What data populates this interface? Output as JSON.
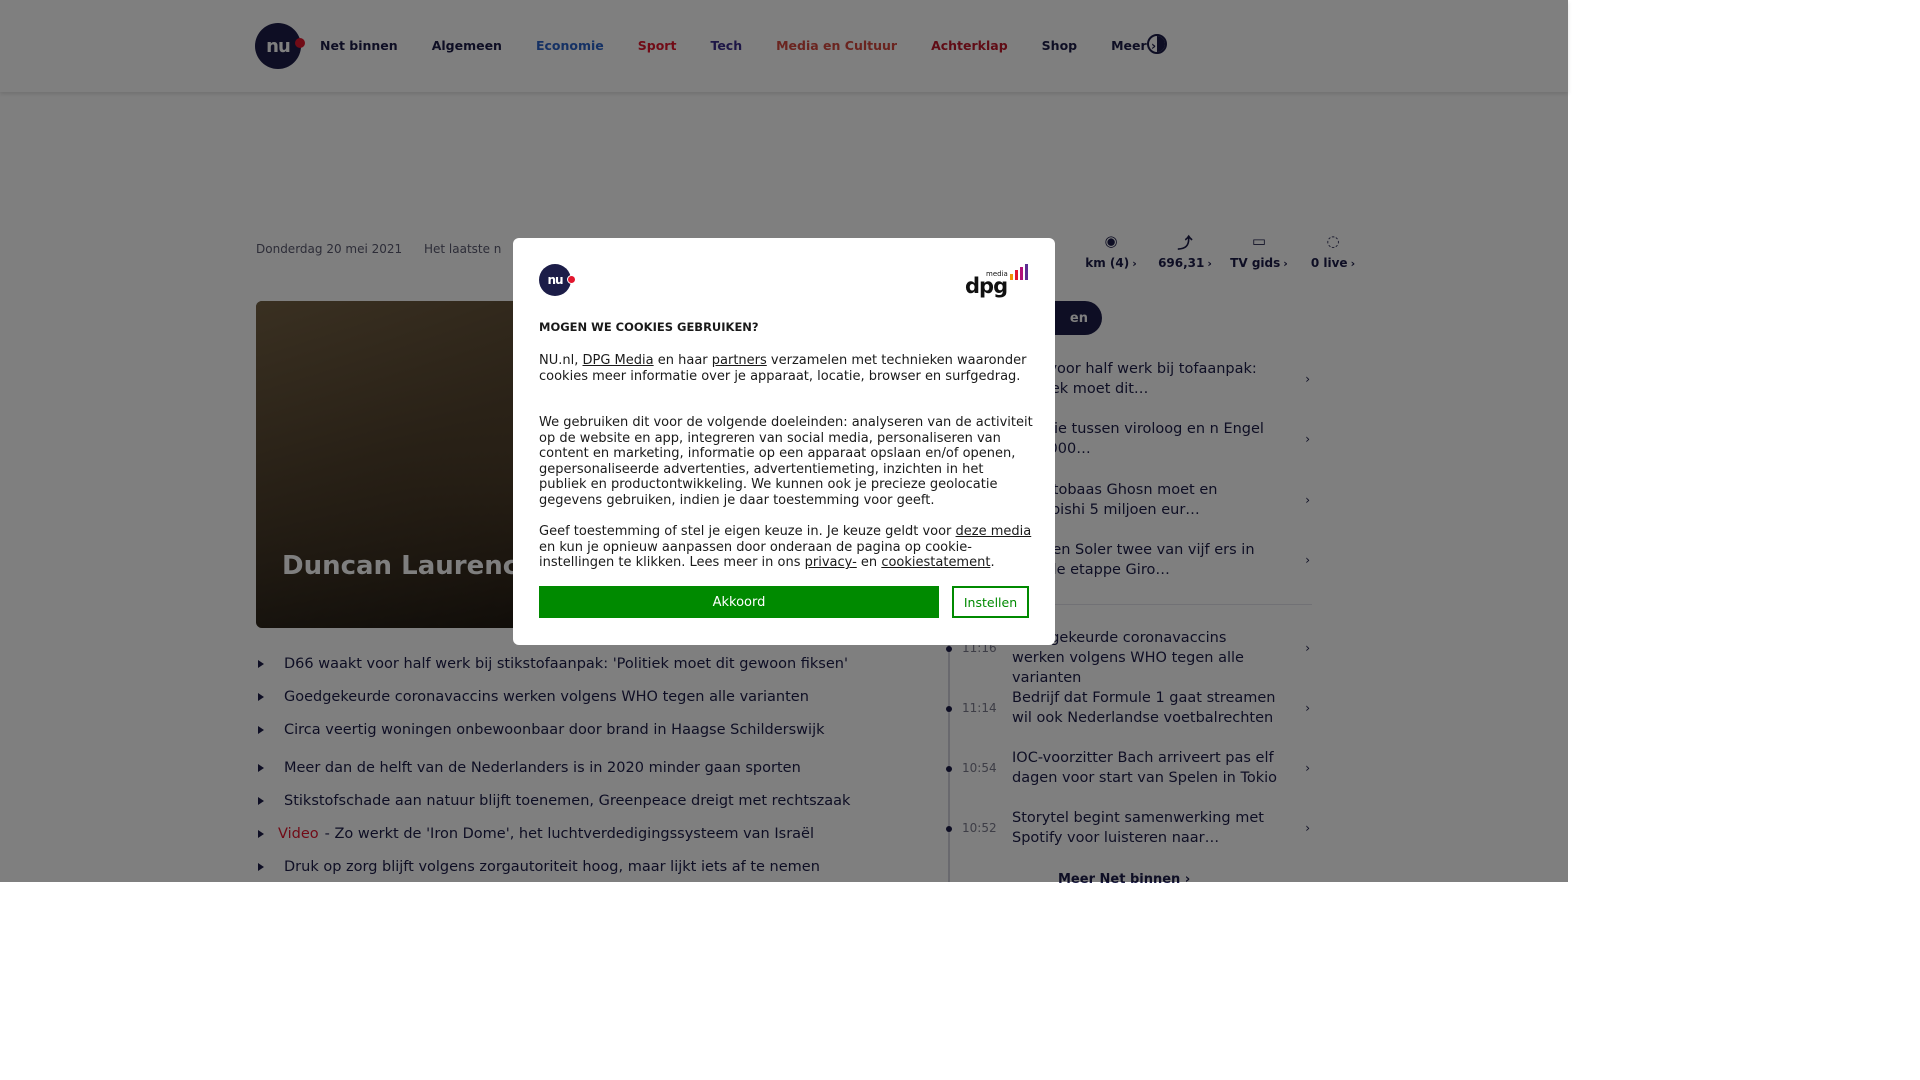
{
  "header": {
    "logo": "nu",
    "nav": [
      {
        "label": "Net binnen",
        "color": "#1c1d48"
      },
      {
        "label": "Algemeen",
        "color": "#1c1d48"
      },
      {
        "label": "Economie",
        "color": "#2a62c9"
      },
      {
        "label": "Sport",
        "color": "#e2162d"
      },
      {
        "label": "Tech",
        "color": "#3b2d8c"
      },
      {
        "label": "Media en Cultuur",
        "color": "#d4493f"
      },
      {
        "label": "Achterklap",
        "color": "#c0182b"
      },
      {
        "label": "Shop",
        "color": "#1c1d48"
      },
      {
        "label": "Meer",
        "color": "#1c1d48"
      }
    ],
    "theme_toggle_icon": "contrast-icon"
  },
  "subbar": {
    "date": "Donderdag 20 mei 2021",
    "latest": "Het laatste n",
    "quicklinks": [
      {
        "icon": "weather-icon",
        "label": ""
      },
      {
        "icon": "traffic-icon",
        "label": "km (4)"
      },
      {
        "icon": "stocks-icon",
        "label": "696,31"
      },
      {
        "icon": "tv-icon",
        "label": "TV gids"
      },
      {
        "icon": "chat-icon",
        "label": "0 live"
      }
    ]
  },
  "hero": {
    "title": "Duncan Laurence geen live gastopt"
  },
  "news": [
    {
      "tag": "",
      "text": "D66 waakt voor half werk bij stikstofaanpak: 'Politiek moet dit gewoon fiksen'"
    },
    {
      "tag": "",
      "text": "Goedgekeurde coronavaccins werken volgens WHO tegen alle varianten"
    },
    {
      "tag": "",
      "text": "Circa veertig woningen onbewoonbaar door brand in Haagse Schilderswijk"
    },
    {
      "tag": "",
      "text": "Meer dan de helft van de Nederlanders is in 2020 minder gaan sporten"
    },
    {
      "tag": "",
      "text": "Stikstofschade aan natuur blijft toenemen, Greenpeace dreigt met rechtszaak"
    },
    {
      "tag": "Video",
      "text": "- Zo werkt de 'Iron Dome', het luchtverdedigingssysteem van Israël"
    },
    {
      "tag": "",
      "text": "Druk op zorg blijft volgens zorgautoriteit hoog, maar lijkt iets af te nemen"
    }
  ],
  "sidebar": {
    "pill": "en",
    "top_items": [
      "aakt voor half werk bij tofaanpak: 'Politiek moet dit…",
      "er-ruzie tussen viroloog en n Engel op 2.000…",
      "en autobaas Ghosn moet en Mitsubishi 5 miljoen eur…",
      "archi en Soler twee van vijf ers in tweede etappe Giro…"
    ],
    "timeline_items": [
      {
        "time": "11:16",
        "text": "Goedgekeurde coronavaccins werken volgens WHO tegen alle varianten"
      },
      {
        "time": "11:14",
        "text": "Bedrijf dat Formule 1 gaat streamen wil ook Nederlandse voetbalrechten"
      },
      {
        "time": "10:54",
        "text": "IOC-voorzitter Bach arriveert pas elf dagen voor start van Spelen in Tokio"
      },
      {
        "time": "10:52",
        "text": "Storytel begint samenwerking met Spotify voor luisteren naar…"
      }
    ],
    "more": "Meer Net binnen"
  },
  "modal": {
    "logo": "nu",
    "brand": {
      "word": "dpg",
      "small": "media",
      "bar_colors": [
        "#f39200",
        "#e2162d",
        "#b1127a",
        "#5c2d91"
      ]
    },
    "title": "MOGEN WE COOKIES GEBRUIKEN?",
    "p1": {
      "a": "NU.nl, ",
      "link1": "DPG Media",
      "b": " en haar ",
      "link2": "partners",
      "c": " verzamelen met technieken waaronder cookies meer informatie over je apparaat, locatie, browser en surfgedrag."
    },
    "p2": "We gebruiken dit voor de volgende doeleinden: analyseren van de activiteit op de website en app, integreren van social media, personaliseren van content en marketing, informatie op een apparaat opslaan en/of openen, gepersonaliseerde advertenties, advertentiemeting, inzichten in het publiek en productontwikkeling. We kunnen ook je precieze geolocatie gegevens gebruiken, indien je daar toestemming voor geeft.",
    "p3": {
      "a": "Geef toestemming of stel je eigen keuze in. Je keuze geldt voor ",
      "link1": "deze media",
      "b": " en kun je opnieuw aanpassen door onderaan de pagina op cookie-instellingen te klikken. Lees meer in ons ",
      "link2": "privacy-",
      "c": " en ",
      "link3": "cookiestatement",
      "d": "."
    },
    "accept_label": "Akkoord",
    "settings_label": "Instellen",
    "accent": "#008a00"
  }
}
